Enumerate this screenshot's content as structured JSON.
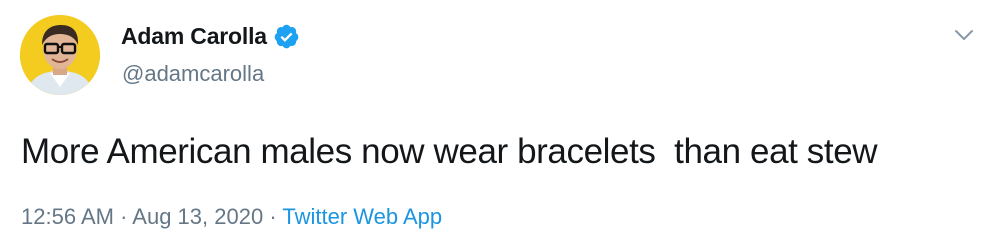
{
  "tweet": {
    "author": {
      "name": "Adam Carolla",
      "handle": "@adamcarolla",
      "verified": true,
      "avatar": "avatar-photo"
    },
    "text": "More American males now wear bracelets  than eat stew",
    "time": "12:56 AM",
    "separator": " · ",
    "date": "Aug 13, 2020",
    "source": "Twitter Web App"
  },
  "colors": {
    "verified_badge": "#1da1f2",
    "link": "#1b95e0",
    "secondary_text": "#657786",
    "avatar_background": "#f3cc1f"
  },
  "icons": {
    "verified": "verified-badge-icon",
    "menu": "chevron-down-icon"
  }
}
